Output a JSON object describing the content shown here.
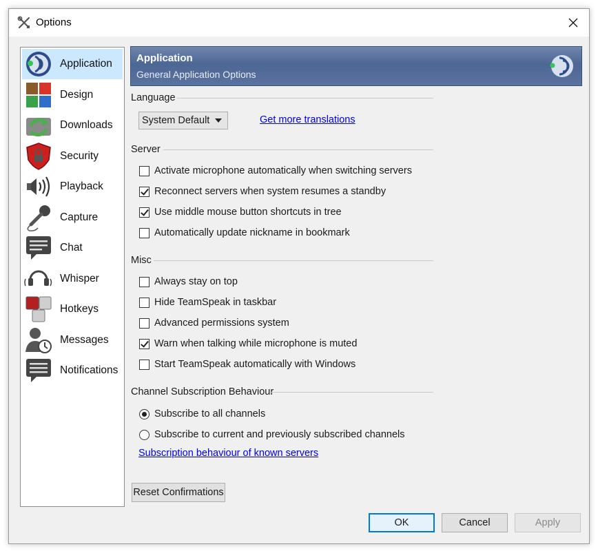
{
  "window": {
    "title": "Options"
  },
  "sidebar": {
    "items": [
      {
        "label": "Application",
        "icon": "application-icon",
        "selected": true
      },
      {
        "label": "Design",
        "icon": "design-icon"
      },
      {
        "label": "Downloads",
        "icon": "downloads-icon"
      },
      {
        "label": "Security",
        "icon": "security-icon"
      },
      {
        "label": "Playback",
        "icon": "playback-icon"
      },
      {
        "label": "Capture",
        "icon": "capture-icon"
      },
      {
        "label": "Chat",
        "icon": "chat-icon"
      },
      {
        "label": "Whisper",
        "icon": "whisper-icon"
      },
      {
        "label": "Hotkeys",
        "icon": "hotkeys-icon"
      },
      {
        "label": "Messages",
        "icon": "messages-icon"
      },
      {
        "label": "Notifications",
        "icon": "notifications-icon"
      }
    ]
  },
  "header": {
    "title": "Application",
    "subtitle": "General Application Options"
  },
  "language": {
    "group_label": "Language",
    "selected": "System Default",
    "link": "Get more translations"
  },
  "server": {
    "group_label": "Server",
    "options": [
      {
        "label": "Activate microphone automatically when switching servers",
        "checked": false
      },
      {
        "label": "Reconnect servers when system resumes a standby",
        "checked": true
      },
      {
        "label": "Use middle mouse button shortcuts in tree",
        "checked": true
      },
      {
        "label": "Automatically update nickname in bookmark",
        "checked": false
      }
    ]
  },
  "misc": {
    "group_label": "Misc",
    "options": [
      {
        "label": "Always stay on top",
        "checked": false
      },
      {
        "label": "Hide TeamSpeak in taskbar",
        "checked": false
      },
      {
        "label": "Advanced permissions system",
        "checked": false
      },
      {
        "label": "Warn when talking while microphone is muted",
        "checked": true
      },
      {
        "label": "Start TeamSpeak automatically with Windows",
        "checked": false
      }
    ]
  },
  "subscription": {
    "group_label": "Channel Subscription Behaviour",
    "options": [
      {
        "label": "Subscribe to all channels",
        "checked": true
      },
      {
        "label": "Subscribe to current and previously subscribed channels",
        "checked": false
      }
    ],
    "link": "Subscription behaviour of known servers"
  },
  "buttons": {
    "reset": "Reset Confirmations",
    "ok": "OK",
    "cancel": "Cancel",
    "apply": "Apply"
  }
}
